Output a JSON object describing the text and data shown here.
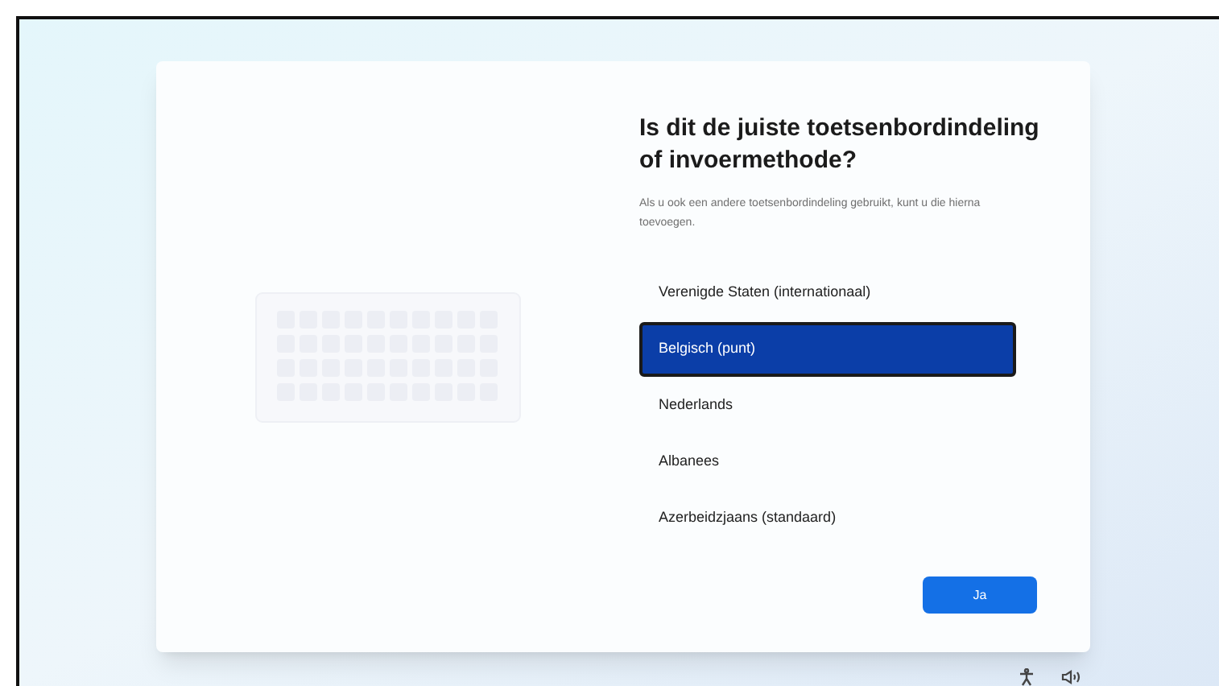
{
  "title": "Is dit de juiste toetsenbordindeling of invoermethode?",
  "subtitle": "Als u ook een andere toetsenbordindeling gebruikt, kunt u die hierna toevoegen.",
  "options": [
    {
      "label": "Verenigde Staten (internationaal)",
      "selected": false
    },
    {
      "label": "Belgisch (punt)",
      "selected": true
    },
    {
      "label": "Nederlands",
      "selected": false
    },
    {
      "label": "Albanees",
      "selected": false
    },
    {
      "label": "Azerbeidzjaans (standaard)",
      "selected": false
    }
  ],
  "primary_button": "Ja"
}
